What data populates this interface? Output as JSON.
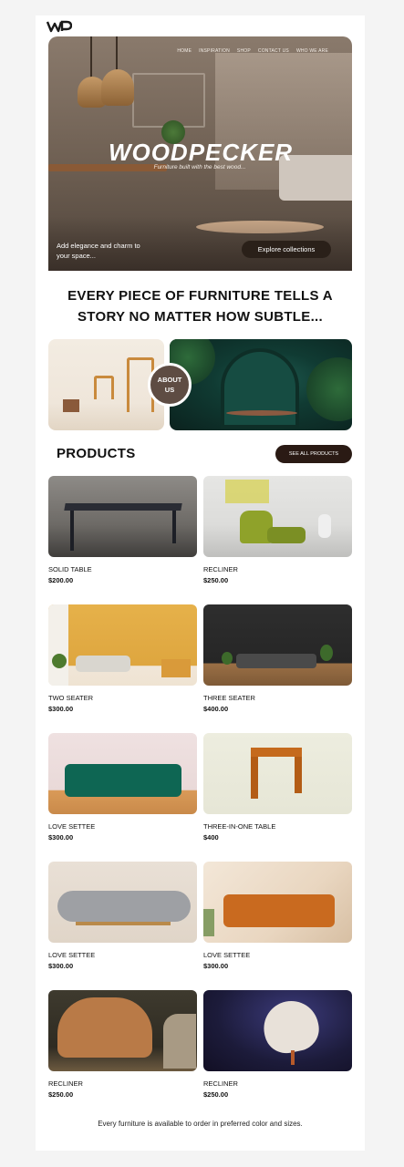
{
  "brand": {
    "logo_text": "WP"
  },
  "nav": {
    "items": [
      "HOME",
      "INSPIRATION",
      "SHOP",
      "CONTACT US",
      "WHO WE ARE"
    ]
  },
  "hero": {
    "title": "WOODPECKER",
    "subtitle": "Furniture built with the best wood...",
    "tagline": "Add elegance and charm to your space...",
    "cta": "Explore collections"
  },
  "headline": "EVERY PIECE OF FURNITURE TELLS A STORY NO MATTER HOW SUBTLE...",
  "about": {
    "line1": "ABOUT",
    "line2": "US"
  },
  "products": {
    "title": "PRODUCTS",
    "see_all": "SEE ALL PRODUCTS",
    "items": [
      {
        "name": "SOLID TABLE",
        "price": "$200.00"
      },
      {
        "name": "RECLINER",
        "price": "$250.00"
      },
      {
        "name": "TWO SEATER",
        "price": "$300.00"
      },
      {
        "name": "THREE SEATER",
        "price": "$400.00"
      },
      {
        "name": "LOVE SETTEE",
        "price": "$300.00"
      },
      {
        "name": "THREE-IN-ONE TABLE",
        "price": "$400"
      },
      {
        "name": "LOVE SETTEE",
        "price": "$300.00"
      },
      {
        "name": "LOVE SETTEE",
        "price": "$300.00"
      },
      {
        "name": "RECLINER",
        "price": "$250.00"
      },
      {
        "name": "RECLINER",
        "price": "$250.00"
      }
    ]
  },
  "footer": {
    "note": "Every furniture is available to order in preferred color and sizes."
  },
  "colors": {
    "dark_button": "#2a1a14",
    "about_circle": "#5e4c43",
    "accent_wood": "#c98a3d"
  }
}
